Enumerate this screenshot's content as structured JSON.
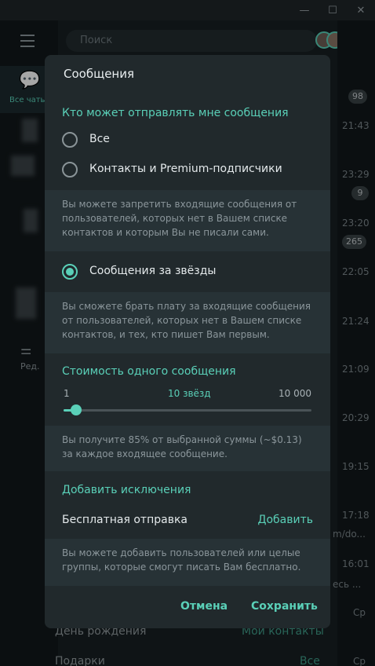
{
  "window": {
    "minimize_icon": "minimize-icon",
    "maximize_icon": "maximize-icon",
    "close_icon": "close-icon"
  },
  "sidebar": {
    "folder_all_label": "Все чаты",
    "edit_label": "Ред."
  },
  "chatlist": {
    "search_placeholder": "Поиск",
    "times": [
      "21:43",
      "23:29",
      "23:20",
      "22:05",
      "21:24",
      "21:09",
      "20:29",
      "19:15",
      "17:18",
      "16:01",
      "Ср",
      "Ср"
    ],
    "badges": [
      "98",
      "9",
      "265"
    ],
    "snippet_1": "m/do...",
    "snippet_2": "есь ..."
  },
  "background_rows": [
    {
      "label": "День рождения",
      "value": "Мои контакты"
    },
    {
      "label": "Подарки",
      "value": "Все"
    }
  ],
  "dialog": {
    "title": "Сообщения",
    "who_can_send_header": "Кто может отправлять мне сообщения",
    "options": [
      {
        "label": "Все",
        "selected": false
      },
      {
        "label": "Контакты и Premium-подписчики",
        "selected": false
      }
    ],
    "note_block": "Вы можете запретить входящие сообщения от пользователей, которых нет в Вашем списке контактов и которым Вы не писали сами.",
    "stars_option": {
      "label": "Сообщения за звёзды",
      "selected": true
    },
    "note_stars": "Вы сможете брать плату за входящие сообщения от пользователей, которых нет в Вашем списке контактов, и тех, кто пишет Вам первым.",
    "price_header": "Стоимость одного сообщения",
    "slider": {
      "min_label": "1",
      "current_label": "10 звёзд",
      "max_label": "10 000",
      "value_fraction": 0.05
    },
    "note_price": "Вы получите 85% от выбранной суммы (~$0.13) за каждое входящее сообщение.",
    "exceptions_header": "Добавить исключения",
    "free_send_label": "Бесплатная отправка",
    "add_label": "Добавить",
    "note_exceptions": "Вы можете добавить пользователей или целые группы, которые смогут писать Вам бесплатно.",
    "cancel_label": "Отмена",
    "save_label": "Сохранить"
  },
  "colors": {
    "accent": "#5ad0b8",
    "dialog_bg": "#21292c",
    "note_bg": "#273236"
  }
}
